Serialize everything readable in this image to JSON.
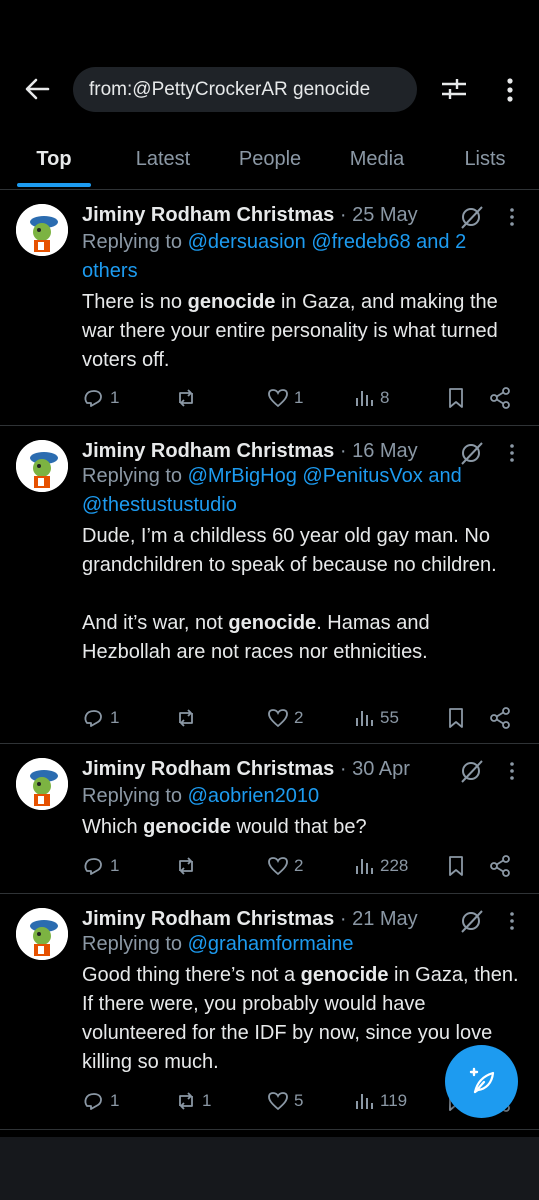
{
  "search": {
    "query": "from:@PettyCrockerAR genocide"
  },
  "tabs": [
    {
      "label": "Top"
    },
    {
      "label": "Latest"
    },
    {
      "label": "People"
    },
    {
      "label": "Media"
    },
    {
      "label": "Lists"
    }
  ],
  "colors": {
    "accent": "#1d9bf0",
    "background": "#000000",
    "muted": "#8b98a5"
  },
  "posts": [
    {
      "name": "Jiminy Rodham Christmas",
      "date": " · 25 May",
      "reply_prefix": "Replying to ",
      "reply_to": "@dersuasion @fredeb68 and 2 others",
      "text_before": "There is no ",
      "keyword": "genocide",
      "text_after": " in Gaza, and making the war there your entire personality is what turned voters off.",
      "replies": "1",
      "reposts": "",
      "likes": "1",
      "views": "8"
    },
    {
      "name": "Jiminy Rodham Christmas",
      "date": " · 16 May",
      "reply_prefix": "Replying to ",
      "reply_to": "@MrBigHog @PenitusVox and @thestustustudio",
      "text_before": "Dude, I’m a childless 60 year old gay man. No grandchildren to speak of because no children.\n\nAnd it’s war, not ",
      "keyword": "genocide",
      "text_after": ". Hamas and Hezbollah are not races nor ethnicities.",
      "replies": "1",
      "reposts": "",
      "likes": "2",
      "views": "55"
    },
    {
      "name": "Jiminy Rodham Christmas",
      "date": " · 30 Apr",
      "reply_prefix": "Replying to ",
      "reply_to": "@aobrien2010",
      "text_before": "Which ",
      "keyword": "genocide",
      "text_after": " would that be?",
      "replies": "1",
      "reposts": "",
      "likes": "2",
      "views": "228"
    },
    {
      "name": "Jiminy Rodham Christmas",
      "date": " · 21 May",
      "reply_prefix": "Replying to ",
      "reply_to": "@grahamformaine",
      "text_before": "Good thing there’s not a ",
      "keyword": "genocide",
      "text_after": " in Gaza, then. If there were, you probably would have volunteered for the IDF by now, since you love killing so much.",
      "replies": "1",
      "reposts": "1",
      "likes": "5",
      "views": "119"
    }
  ]
}
